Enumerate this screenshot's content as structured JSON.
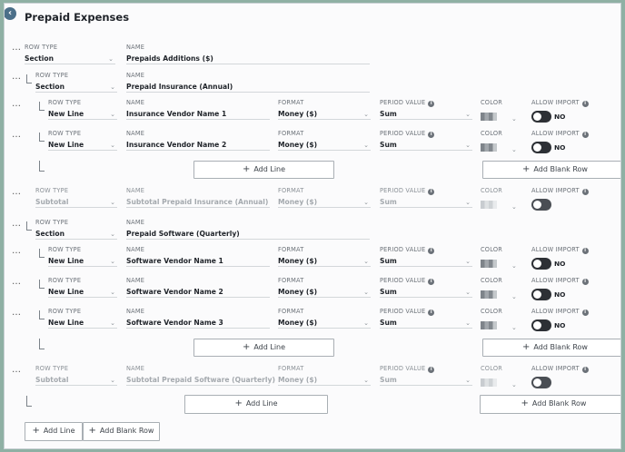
{
  "page": {
    "title": "Prepaid Expenses"
  },
  "labels": {
    "row_type": "ROW TYPE",
    "name": "NAME",
    "format": "FORMAT",
    "period_value": "PERIOD VALUE",
    "color": "COLOR",
    "allow_import": "ALLOW IMPORT",
    "toggle_no": "NO",
    "add_line": "Add Line",
    "add_blank_row": "Add Blank Row",
    "more": "…",
    "chevron": "⌄",
    "plus": "+"
  },
  "rows": [
    {
      "row_type": "Section",
      "name": "Prepaids Additions ($)"
    },
    {
      "row_type": "Section",
      "name": "Prepaid Insurance (Annual)"
    },
    {
      "row_type": "New Line",
      "name": "Insurance Vendor Name 1",
      "format": "Money ($)",
      "period_value": "Sum",
      "allow_import": false
    },
    {
      "row_type": "New Line",
      "name": "Insurance Vendor Name 2",
      "format": "Money ($)",
      "period_value": "Sum",
      "allow_import": false
    },
    {
      "row_type": "Subtotal",
      "name": "Subtotal Prepaid Insurance (Annual)",
      "format": "Money ($)",
      "period_value": "Sum"
    },
    {
      "row_type": "Section",
      "name": "Prepaid Software (Quarterly)"
    },
    {
      "row_type": "New Line",
      "name": "Software Vendor Name 1",
      "format": "Money ($)",
      "period_value": "Sum",
      "allow_import": false
    },
    {
      "row_type": "New Line",
      "name": "Software Vendor Name 2",
      "format": "Money ($)",
      "period_value": "Sum",
      "allow_import": false
    },
    {
      "row_type": "New Line",
      "name": "Software Vendor Name 3",
      "format": "Money ($)",
      "period_value": "Sum",
      "allow_import": false
    },
    {
      "row_type": "Subtotal",
      "name": "Subtotal Prepaid Software (Quarterly)",
      "format": "Money ($)",
      "period_value": "Sum"
    }
  ],
  "colors": {
    "toggle_off": "#2d3035",
    "accent_icon": "#4b6f89"
  }
}
